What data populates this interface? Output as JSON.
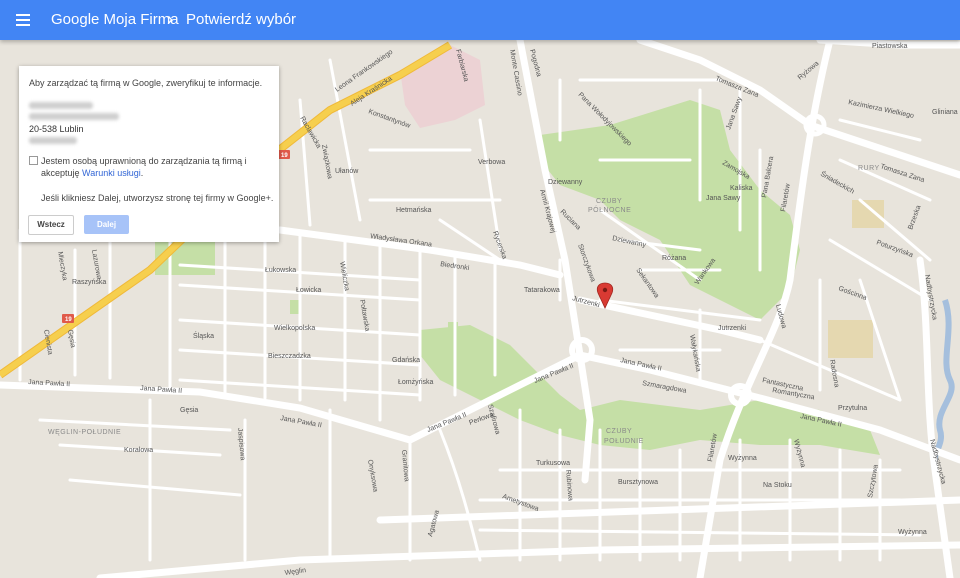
{
  "header": {
    "title": "Google Moja Firma",
    "separator": "›",
    "breadcrumb": "Potwierdź wybór"
  },
  "dialog": {
    "intro": "Aby zarządzać tą firmą w Google, zweryfikuj te informacje.",
    "postcode_city": "20-538 Lublin",
    "checkbox_checked": false,
    "checkbox_text": "Jestem osobą uprawnioną do zarządzania tą firmą i akceptuję",
    "terms_link": "Warunki usługi",
    "terms_period": ".",
    "note": "Jeśli klikniesz Dalej, utworzysz stronę tej firmy w Google+.",
    "back_button": "Wstecz",
    "next_button": "Dalej"
  },
  "map": {
    "colors": {
      "background": "#e8e4dc",
      "road": "#ffffff",
      "highway": "#f6cf4e",
      "park": "#c5dfa6",
      "hospital": "#ecd2d4",
      "water": "#a5bfdd",
      "pin": "#d93a33"
    },
    "pin_icon": "map-marker-icon",
    "labels": {
      "krasnicka": "Aleja Kraśnicka",
      "leona": "Leona Frankowskiego",
      "konstantynow": "Konstantynów",
      "zwiazkowa": "Związkowa",
      "ulanow": "Ułanów",
      "verbowa": "Verbowa",
      "hetmanska": "Hetmańska",
      "orkana": "Władysława Orkana",
      "biedronki": "Biedronki",
      "lukowska": "Łukowska",
      "lowicka": "Łowicka",
      "wieliczka": "Wieliczka",
      "poltawska": "Połtawska",
      "wielkopolska": "Wielkopolska",
      "slaska": "Śląska",
      "bieszczadzka": "Bieszczadzka",
      "gdanska": "Gdańska",
      "lomzynska": "Łomżyńska",
      "jp_west": "Jana Pawła II",
      "jp_mid": "Jana Pawła II",
      "jp_mid2": "Jana Pawła II",
      "jp_east": "Jana Pawła II",
      "jp_east2": "Jana Pawła II",
      "weglin": "WĘGLIN-POŁUDNIE",
      "gesia": "Gęsia",
      "gesia2": "Gęsia",
      "koralowa": "Koralowa",
      "raszynska": "Raszyńska",
      "lazurowa": "Lazurowa",
      "jaspisowa": "Jaspisowa",
      "granitowa": "Granitowa",
      "onyksowa": "Onyksowa",
      "weglin_st": "Węglin",
      "tatarakowa": "Tatarakowa",
      "jutrzenki": "Jutrzenki",
      "jutrzenki2": "Jutrzenki",
      "czuby_n": "CZUBY",
      "czuby_n2": "PÓŁNOCNE",
      "czuby_s": "CZUBY",
      "czuby_s2": "POŁUDNIE",
      "armii": "Armii Krajowej",
      "szmaragdowa": "Szmaragdowa",
      "waleriana": "Walerianiska",
      "fantastyczna": "Fantastyczna",
      "romantyczna": "Romantyczna",
      "przytulna": "Przytulna",
      "filaretow": "Filaretów",
      "filaretow2": "Filaretów",
      "wyzynna": "Wyżynna",
      "wyzynna2": "Wyżynna",
      "nastoku": "Na Stoku",
      "szczytowa": "Szczytowa",
      "turkusowa": "Turkusowa",
      "rubinowa": "Rubinowa",
      "ametystowa": "Ametystowa",
      "bursztynowa": "Bursztynowa",
      "agatowa": "Agatowa",
      "szafirowa": "Szafirowa",
      "perlowa": "Perłowa",
      "rury": "RURY",
      "tomasza": "Tomasza Zana",
      "tomasza2": "Tomasza Zana",
      "kazimierza": "Kazimierza Wielkiego",
      "piastowska": "Piastowska",
      "glinianna": "Gliniana",
      "nadbystrzycka": "Nadbystrzycka",
      "nadbystrzycka2": "Nadbystrzycka",
      "pana": "Pana Wołodyjowskiego",
      "zamojska": "Zamojska",
      "kaliska": "Kaliska",
      "sawy": "Jana Sawy",
      "sawy2": "Jana Sawy",
      "sawy3": "Jana Sawy",
      "balcera": "Pana Balcera",
      "rycerska": "Rycerska",
      "dziewanny": "Dziewanny",
      "dziewanny2": "Dziewanny",
      "ruciana": "Ruciana",
      "storczykowa": "Storczykowa",
      "rozana": "Różana",
      "sekantowa": "Sekantowa",
      "wanikowa": "Wankowa",
      "walykanska": "Wałykańska",
      "mieczyk": "Mieczyka",
      "sniadeckich": "Śniadeckich",
      "poturzynska": "Poturzyńska",
      "zmijewska": "Żmijewska",
      "brzeska": "Brzeska",
      "radosna": "Radosna",
      "goscinna": "Gościnna",
      "ludowa": "Ludowa",
      "ryzowa": "Ryżowa",
      "cienista": "Cienista",
      "farbiarska": "Farbiarska",
      "monte": "Monte Cassino",
      "pogodna": "Pogodna",
      "raclawicka": "Raclawicka",
      "rycerska2": "Ryc.",
      "r19a": "19",
      "r19b": "19",
      "r19c": "19"
    }
  }
}
